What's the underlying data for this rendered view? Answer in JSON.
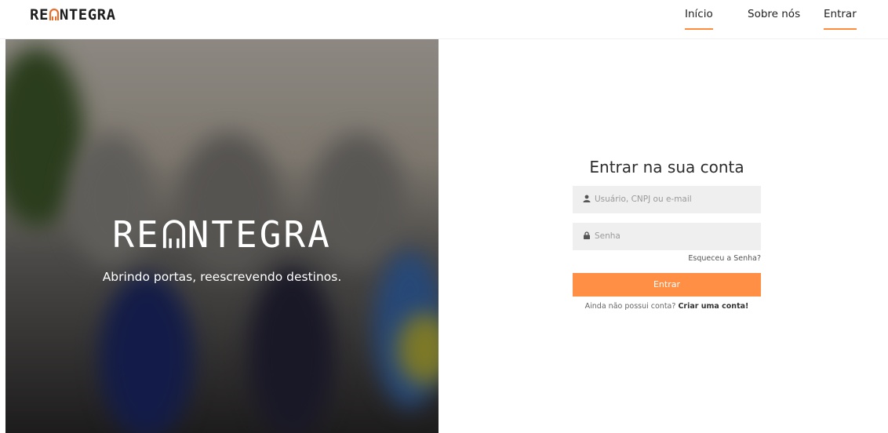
{
  "header": {
    "brand_pre": "RE",
    "brand_post": "NTEGRA",
    "nav": [
      {
        "label": "Início"
      },
      {
        "label": "Sobre nós"
      },
      {
        "label": "Entrar"
      }
    ]
  },
  "hero": {
    "title_pre": "RE",
    "title_post": "NTEGRA",
    "tagline": "Abrindo portas, reescrevendo destinos."
  },
  "login": {
    "title": "Entrar na sua conta",
    "user_placeholder": "Usuário, CNPJ ou e-mail",
    "pass_placeholder": "Senha",
    "forgot": "Esqueceu a Senha?",
    "button": "Entrar",
    "no_account": "Ainda não possui conta?",
    "create_account": "Criar uma conta!"
  },
  "colors": {
    "accent": "#ff8f45",
    "field_bg": "#efefef",
    "text_dark": "#2d2d2d"
  },
  "icons": {
    "user": "user-icon",
    "lock": "lock-icon",
    "brand_key": "keyhole-icon"
  }
}
